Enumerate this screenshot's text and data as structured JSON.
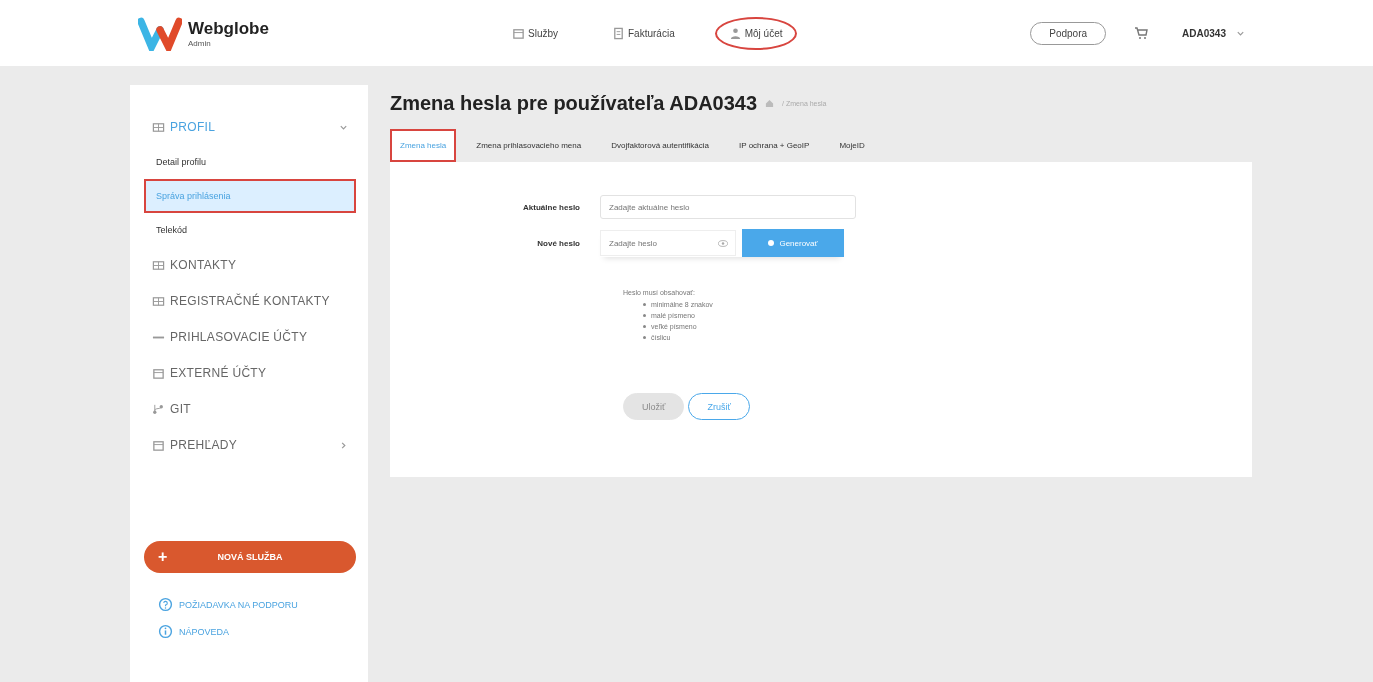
{
  "header": {
    "logo": {
      "name": "Webglobe",
      "subtitle": "Admin"
    },
    "nav": [
      {
        "label": "Služby",
        "highlighted": false
      },
      {
        "label": "Fakturácia",
        "highlighted": false
      },
      {
        "label": "Môj účet",
        "highlighted": true
      }
    ],
    "support_button": "Podpora",
    "user": "ADA0343"
  },
  "sidebar": {
    "items": [
      {
        "label": "PROFIL",
        "selected": true,
        "expanded": true,
        "children": [
          {
            "label": "Detail profilu",
            "selected": false,
            "highlighted": false
          },
          {
            "label": "Správa prihlásenia",
            "selected": true,
            "highlighted": true
          },
          {
            "label": "Telekód",
            "selected": false,
            "highlighted": false
          }
        ]
      },
      {
        "label": "KONTAKTY",
        "selected": false
      },
      {
        "label": "REGISTRAČNÉ KONTAKTY",
        "selected": false
      },
      {
        "label": "PRIHLASOVACIE ÚČTY",
        "selected": false
      },
      {
        "label": "EXTERNÉ ÚČTY",
        "selected": false
      },
      {
        "label": "GIT",
        "selected": false
      },
      {
        "label": "PREHĽADY",
        "selected": false,
        "expanded": false
      }
    ],
    "new_service_button": {
      "icon": "+",
      "label": "NOVÁ SLUŽBA"
    },
    "links": [
      {
        "label": "POŽIADAVKA NA PODPORU"
      },
      {
        "label": "NÁPOVEDA"
      }
    ]
  },
  "main": {
    "title": "Zmena hesla pre používateľa ADA0343",
    "breadcrumb": "/ Zmena hesla",
    "tabs": [
      {
        "label": "Zmena hesla",
        "selected": true,
        "highlighted": true
      },
      {
        "label": "Zmena prihlasovacieho mena",
        "selected": false,
        "highlighted": false
      },
      {
        "label": "Dvojfaktorová autentifikácia",
        "selected": false,
        "highlighted": false
      },
      {
        "label": "IP ochrana + GeoIP",
        "selected": false,
        "highlighted": false
      },
      {
        "label": "MojeID",
        "selected": false,
        "highlighted": false
      }
    ],
    "form": {
      "current_password": {
        "label": "Aktuálne heslo",
        "placeholder": "Zadajte aktuálne heslo"
      },
      "new_password": {
        "label": "Nové heslo",
        "placeholder": "Zadajte heslo"
      },
      "generate_button": "Generovať",
      "rules_title": "Heslo musí obsahovať:",
      "rules": [
        "minimálne 8 znakov",
        "malé písmeno",
        "veľké písmeno",
        "číslicu"
      ],
      "save_button": {
        "label": "Uložiť",
        "disabled": true
      },
      "cancel_button": "Zrušiť"
    }
  }
}
